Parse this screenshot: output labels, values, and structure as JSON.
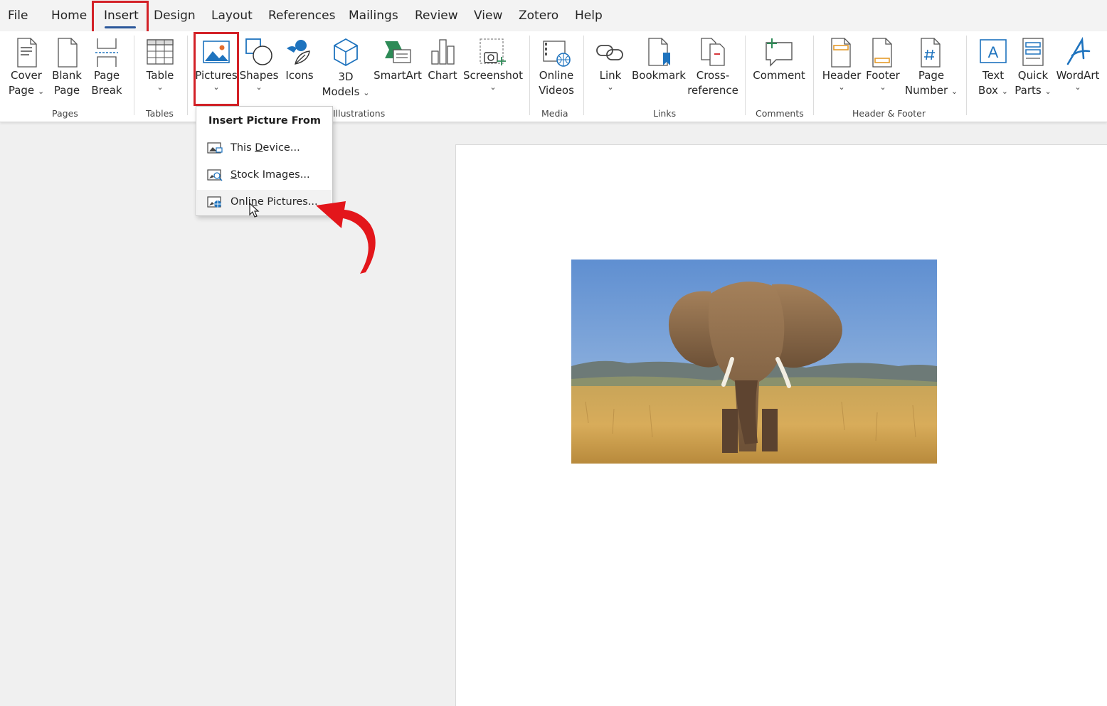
{
  "tabs": [
    "File",
    "Home",
    "Insert",
    "Design",
    "Layout",
    "References",
    "Mailings",
    "Review",
    "View",
    "Zotero",
    "Help"
  ],
  "active_tab": "Insert",
  "ribbon": {
    "cover_page": [
      "Cover",
      "Page"
    ],
    "blank_page": [
      "Blank",
      "Page"
    ],
    "page_break": [
      "Page",
      "Break"
    ],
    "table": "Table",
    "pictures": "Pictures",
    "shapes": "Shapes",
    "icons": "Icons",
    "models_3d": [
      "3D",
      "Models"
    ],
    "smartart": "SmartArt",
    "chart": "Chart",
    "screenshot": "Screenshot",
    "online_videos": [
      "Online",
      "Videos"
    ],
    "link": "Link",
    "bookmark": "Bookmark",
    "cross_reference": [
      "Cross-",
      "reference"
    ],
    "comment": "Comment",
    "header": "Header",
    "footer": "Footer",
    "page_number": [
      "Page",
      "Number"
    ],
    "text_box": [
      "Text",
      "Box"
    ],
    "quick_parts": [
      "Quick",
      "Parts"
    ],
    "wordart": "WordArt"
  },
  "groups": {
    "pages": "Pages",
    "tables": "Tables",
    "illustrations": "Illustrations",
    "media": "Media",
    "links": "Links",
    "comments": "Comments",
    "header_footer": "Header & Footer"
  },
  "dropdown": {
    "title": "Insert Picture From",
    "items": [
      {
        "pre": "This ",
        "key": "D",
        "post": "evice..."
      },
      {
        "pre": "",
        "key": "S",
        "post": "tock Images..."
      },
      {
        "pre": "Onli",
        "key": "n",
        "post": "e Pictures..."
      }
    ]
  },
  "colors": {
    "accent_blue": "#2b579a",
    "highlight_red": "#d32127",
    "icon_blue": "#1e73be",
    "icon_green": "#2e8b57"
  }
}
